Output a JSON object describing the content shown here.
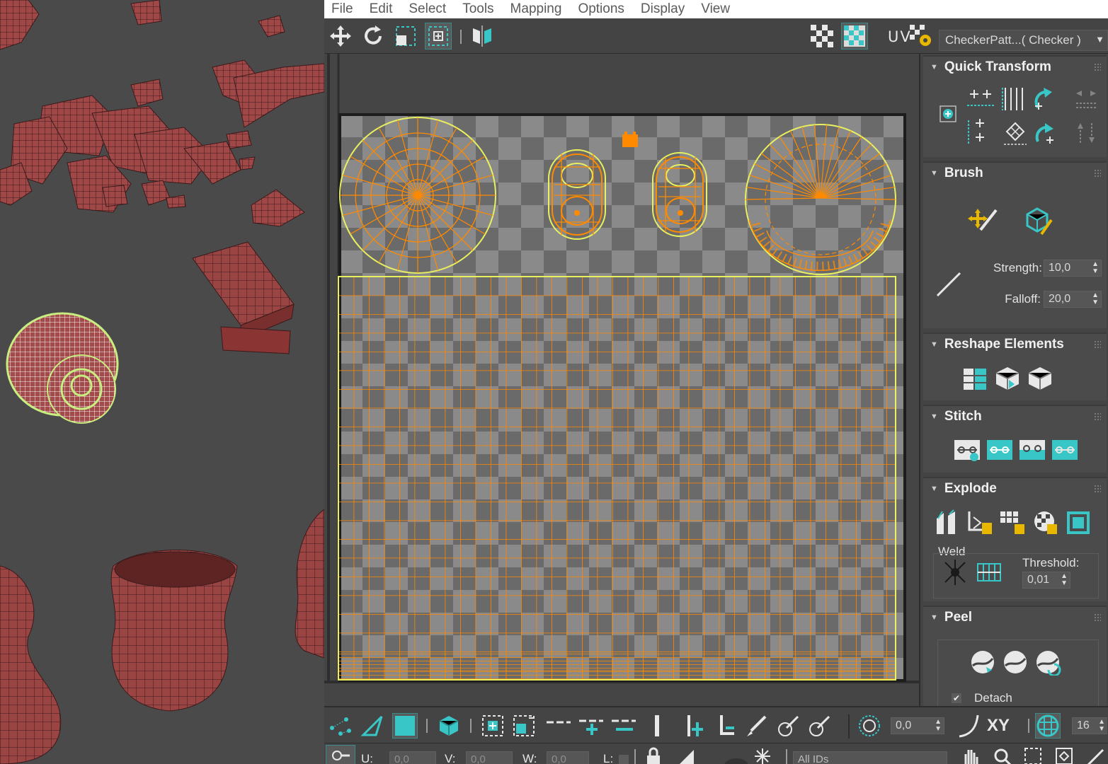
{
  "menu": [
    "File",
    "Edit",
    "Select",
    "Tools",
    "Mapping",
    "Options",
    "Display",
    "View"
  ],
  "toolbar": {
    "uv_label": "UV",
    "texture_dropdown": "CheckerPatt...( Checker )"
  },
  "panel": {
    "quick_transform": {
      "title": "Quick Transform"
    },
    "brush": {
      "title": "Brush",
      "strength_label": "Strength:",
      "strength_value": "10,0",
      "falloff_label": "Falloff:",
      "falloff_value": "20,0"
    },
    "reshape": {
      "title": "Reshape Elements"
    },
    "stitch": {
      "title": "Stitch"
    },
    "explode": {
      "title": "Explode",
      "weld_label": "Weld",
      "threshold_label": "Threshold:",
      "threshold_value": "0,01"
    },
    "peel": {
      "title": "Peel",
      "detach_label": "Detach",
      "detach_checked": true
    }
  },
  "bottom_toolbar": {
    "angle_value": "0,0",
    "xy_label": "XY",
    "grid_value": "16"
  },
  "status_bar": {
    "u_label": "U:",
    "u_value": "0,0",
    "v_label": "V:",
    "v_value": "0,0",
    "w_label": "W:",
    "w_value": "0,0",
    "l_label": "L:",
    "ids_dropdown": "All IDs"
  },
  "colors": {
    "accent": "#39c6c6",
    "uv_edge": "#ff8a00",
    "uv_border": "#e8f060",
    "mesh": "#8e3b3b",
    "menubar": "#ffffff",
    "panel_bg": "#4b4b4b"
  }
}
